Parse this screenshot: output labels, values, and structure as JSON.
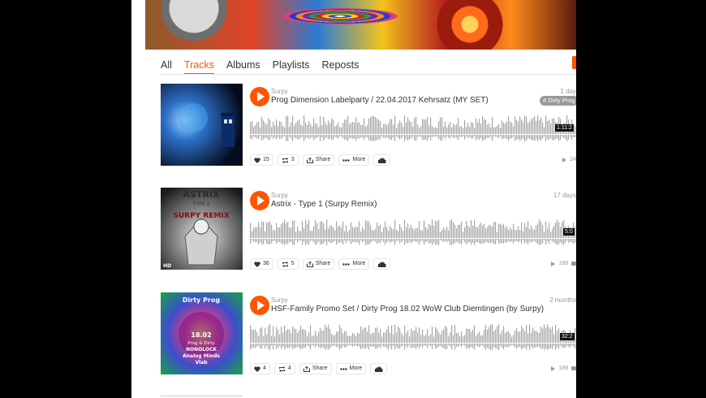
{
  "tabs": [
    {
      "label": "All",
      "active": false
    },
    {
      "label": "Tracks",
      "active": true
    },
    {
      "label": "Albums",
      "active": false
    },
    {
      "label": "Playlists",
      "active": false
    },
    {
      "label": "Reposts",
      "active": false
    }
  ],
  "accent_color": "#ff5500",
  "tracks": [
    {
      "artist": "Surpy",
      "title": "Prog Dimension Labelparty / 22.04.2017 Kehrsatz (MY SET)",
      "age": "1 day",
      "tag": "# Dirty Prog",
      "duration": "1:11:2",
      "likes": "15",
      "reposts": "3",
      "share": "Share",
      "more": "More",
      "plays": "24",
      "art_icons": [
        "police-box-icon"
      ]
    },
    {
      "artist": "Surpy",
      "title": "Astrix - Type 1 (Surpy Remix)",
      "age": "17 days",
      "tag": "",
      "duration": "5:0",
      "likes": "36",
      "reposts": "5",
      "share": "Share",
      "more": "More",
      "plays": "199",
      "art_text": [
        "ASTRIX",
        "TYPE 1",
        "SURPY REMIX",
        "HD"
      ]
    },
    {
      "artist": "Surpy",
      "title": "HSF-Family Promo Set / Dirty Prog 18.02 WoW Club Diemtingen (by Surpy)",
      "age": "2 months",
      "tag": "",
      "duration": "32:2",
      "likes": "4",
      "reposts": "4",
      "share": "Share",
      "more": "More",
      "plays": "189",
      "art_text": [
        "Dirty Prog",
        "18.02",
        "Prog & Dirty",
        "NONOLOCK",
        "Analog Minds",
        "Vlab"
      ]
    }
  ]
}
